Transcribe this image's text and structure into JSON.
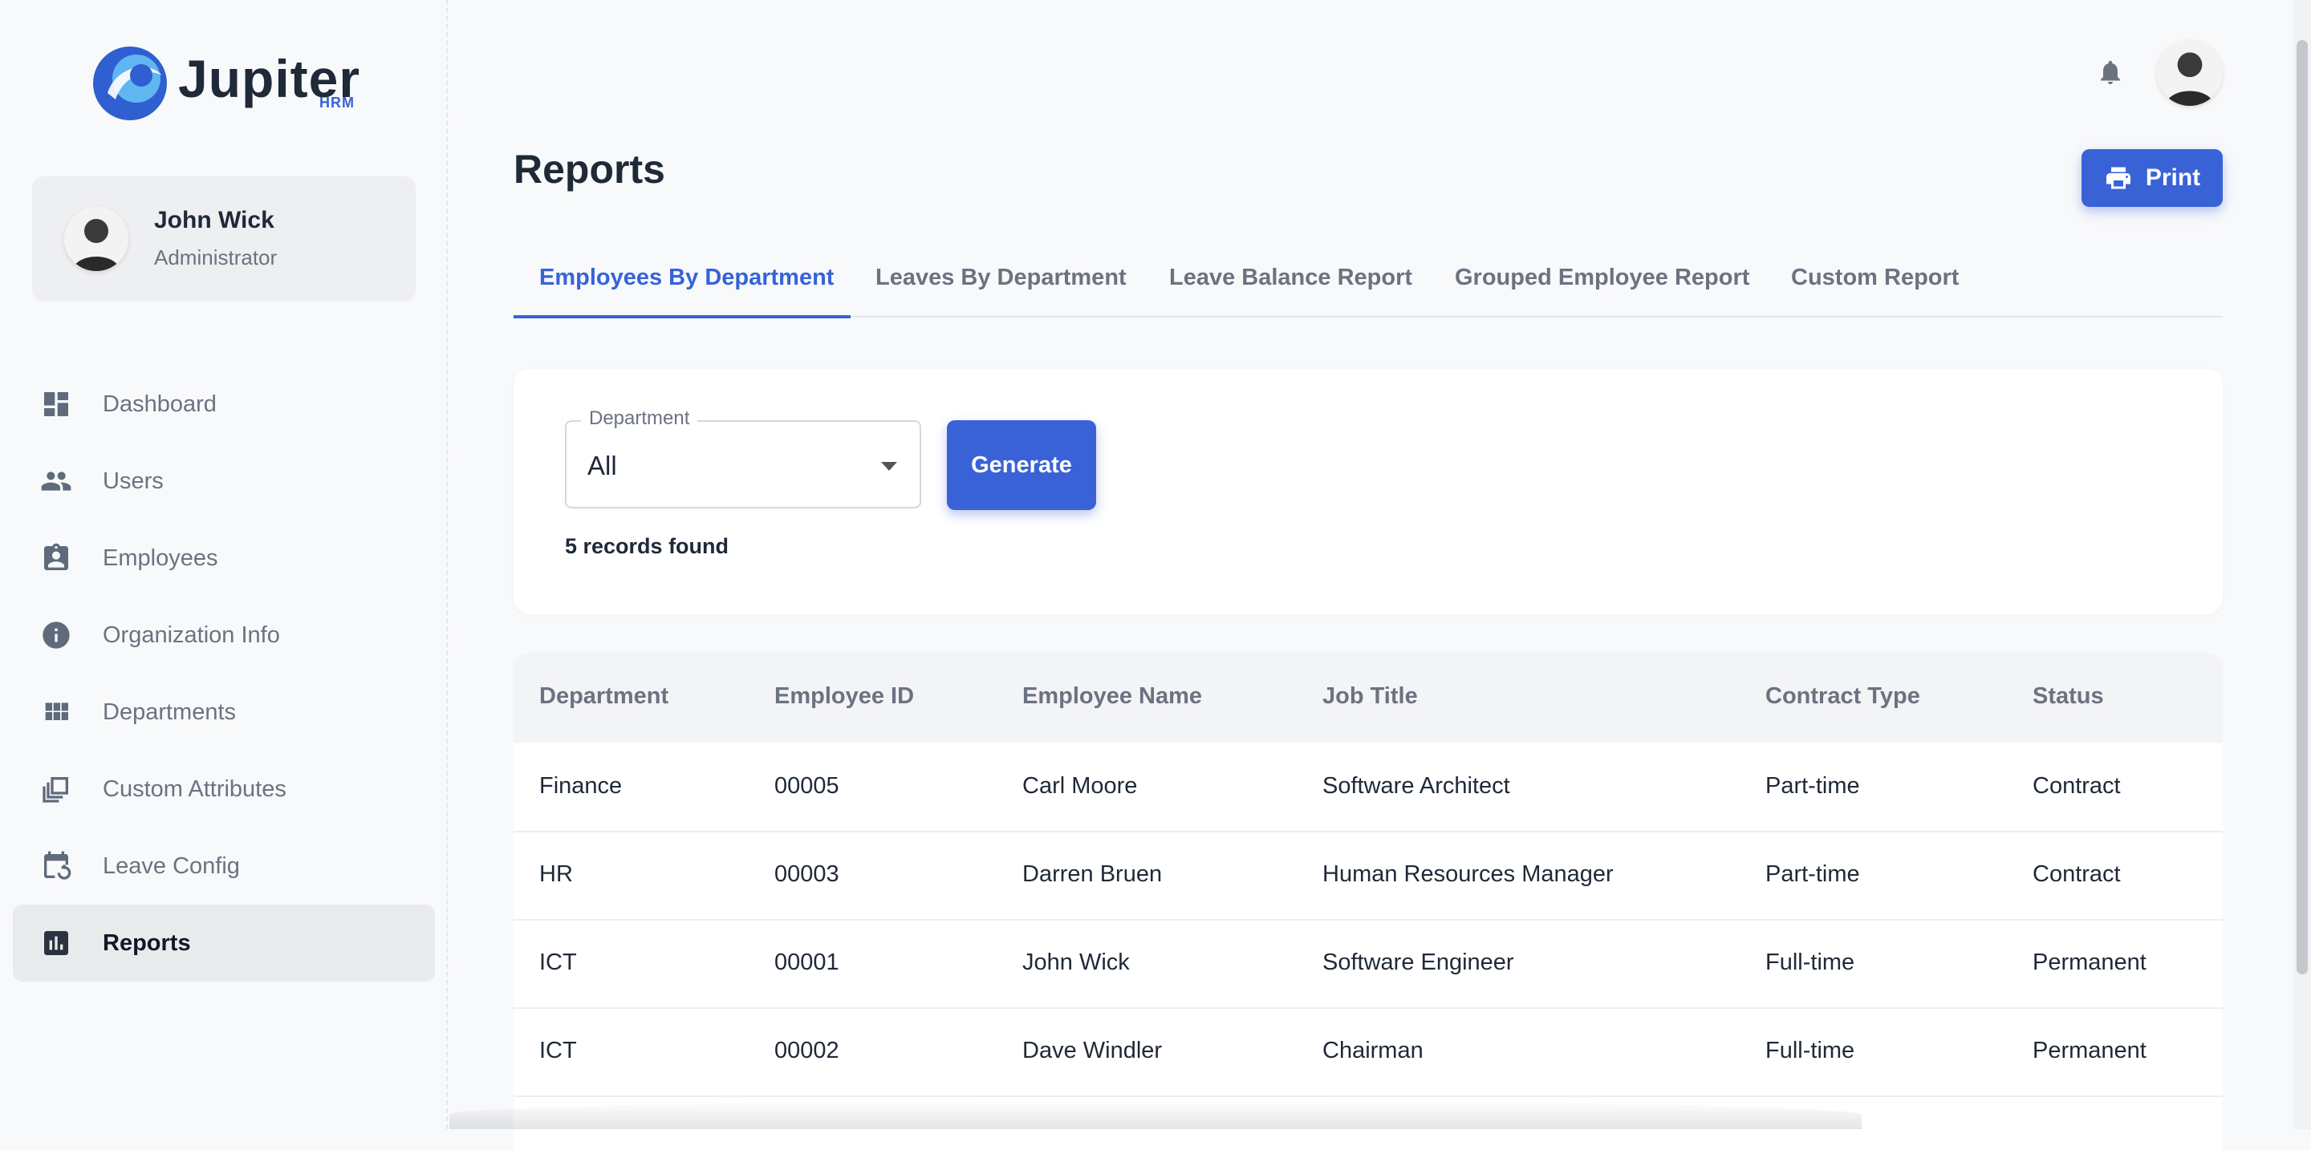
{
  "app": {
    "logo_text": "Jupiter",
    "logo_sub": "HRM",
    "brand_color": "#3563d8"
  },
  "user": {
    "name": "John Wick",
    "role": "Administrator"
  },
  "sidebar": {
    "items": [
      {
        "label": "Dashboard",
        "icon": "dashboard-icon",
        "active": false
      },
      {
        "label": "Users",
        "icon": "users-icon",
        "active": false
      },
      {
        "label": "Employees",
        "icon": "employee-badge-icon",
        "active": false
      },
      {
        "label": "Organization Info",
        "icon": "info-icon",
        "active": false
      },
      {
        "label": "Departments",
        "icon": "grid-icon",
        "active": false
      },
      {
        "label": "Custom Attributes",
        "icon": "layers-icon",
        "active": false
      },
      {
        "label": "Leave Config",
        "icon": "calendar-refresh-icon",
        "active": false
      },
      {
        "label": "Reports",
        "icon": "bar-chart-icon",
        "active": true
      }
    ]
  },
  "header": {
    "title": "Reports",
    "print_label": "Print"
  },
  "tabs": [
    {
      "label": "Employees By Department",
      "active": true
    },
    {
      "label": "Leaves By Department",
      "active": false
    },
    {
      "label": "Leave Balance Report",
      "active": false
    },
    {
      "label": "Grouped Employee Report",
      "active": false
    },
    {
      "label": "Custom Report",
      "active": false
    }
  ],
  "filter": {
    "department_label": "Department",
    "department_value": "All",
    "generate_label": "Generate",
    "records_text": "5 records found"
  },
  "table": {
    "columns": [
      "Department",
      "Employee ID",
      "Employee Name",
      "Job Title",
      "Contract Type",
      "Status"
    ],
    "rows": [
      [
        "Finance",
        "00005",
        "Carl Moore",
        "Software Architect",
        "Part-time",
        "Contract"
      ],
      [
        "HR",
        "00003",
        "Darren Bruen",
        "Human Resources Manager",
        "Part-time",
        "Contract"
      ],
      [
        "ICT",
        "00001",
        "John Wick",
        "Software Engineer",
        "Full-time",
        "Permanent"
      ],
      [
        "ICT",
        "00002",
        "Dave Windler",
        "Chairman",
        "Full-time",
        "Permanent"
      ]
    ]
  }
}
